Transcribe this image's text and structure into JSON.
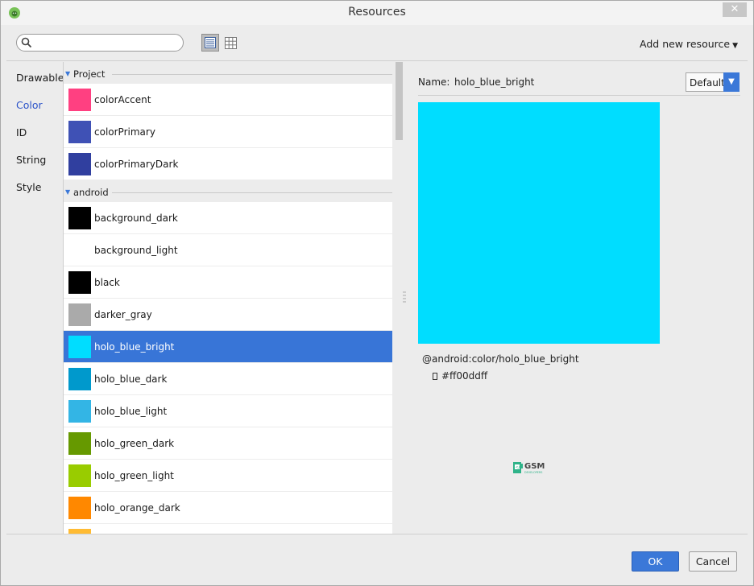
{
  "window": {
    "title": "Resources",
    "close_glyph": "✕",
    "app_icon": "android-studio-icon"
  },
  "toolbar": {
    "search_placeholder": "",
    "search_value": "",
    "list_view_icon": "list-view-icon",
    "grid_view_icon": "grid-view-icon",
    "add_new_resource_label": "Add new resource"
  },
  "categories": [
    {
      "label": "Drawable",
      "active": false
    },
    {
      "label": "Color",
      "active": true
    },
    {
      "label": "ID",
      "active": false
    },
    {
      "label": "String",
      "active": false
    },
    {
      "label": "Style",
      "active": false
    }
  ],
  "groups": [
    {
      "name": "Project",
      "items": [
        {
          "name": "colorAccent",
          "color": "#ff4081"
        },
        {
          "name": "colorPrimary",
          "color": "#3f51b5"
        },
        {
          "name": "colorPrimaryDark",
          "color": "#303f9f"
        }
      ]
    },
    {
      "name": "android",
      "items": [
        {
          "name": "background_dark",
          "color": "#000000"
        },
        {
          "name": "background_light",
          "color": "#ffffff"
        },
        {
          "name": "black",
          "color": "#000000"
        },
        {
          "name": "darker_gray",
          "color": "#aaaaaa"
        },
        {
          "name": "holo_blue_bright",
          "color": "#00ddff",
          "selected": true
        },
        {
          "name": "holo_blue_dark",
          "color": "#0099cc"
        },
        {
          "name": "holo_blue_light",
          "color": "#33b5e5"
        },
        {
          "name": "holo_green_dark",
          "color": "#669900"
        },
        {
          "name": "holo_green_light",
          "color": "#99cc00"
        },
        {
          "name": "holo_orange_dark",
          "color": "#ff8800"
        },
        {
          "name": "",
          "color": "#ffbb33"
        }
      ]
    }
  ],
  "detail": {
    "name_label": "Name:",
    "name_value": "holo_blue_bright",
    "configuration": "Default",
    "preview_color": "#00ddff",
    "reference": "@android:color/holo_blue_bright",
    "hex_value": "#ff00ddff"
  },
  "watermark": {
    "text": "GSM",
    "subtext": "DEVELOPERS"
  },
  "footer": {
    "ok_label": "OK",
    "cancel_label": "Cancel"
  },
  "colors": {
    "accent": "#3b78d8",
    "selection": "#3875d7"
  }
}
